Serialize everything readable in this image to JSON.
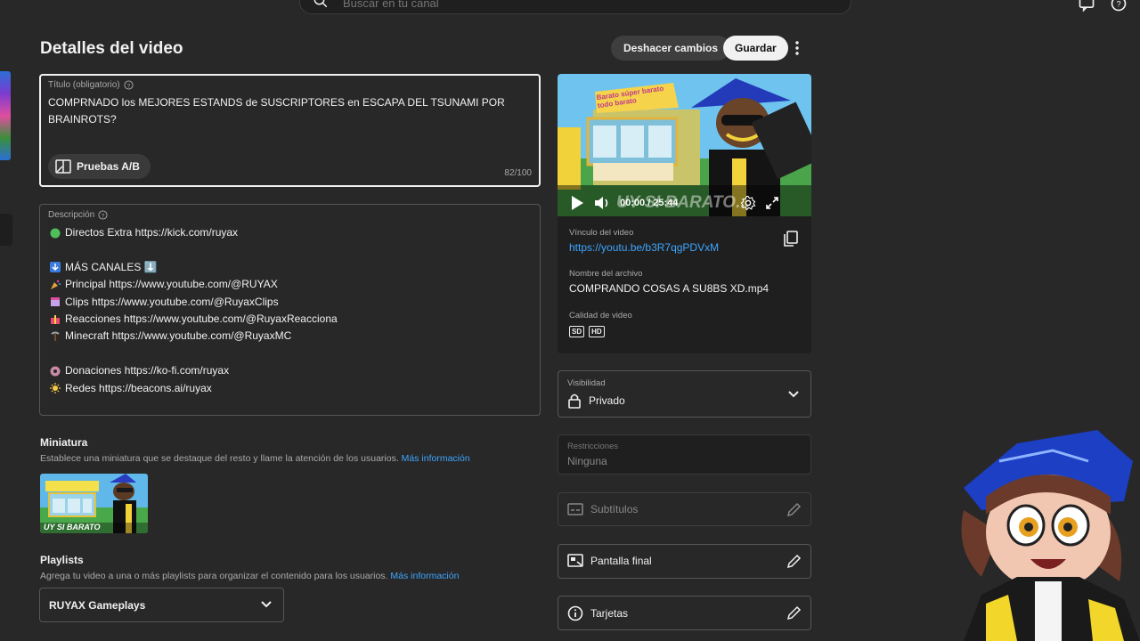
{
  "search": {
    "placeholder": "Buscar en tu canal"
  },
  "page": {
    "title": "Detalles del video"
  },
  "toolbar": {
    "undo_label": "Deshacer cambios",
    "save_label": "Guardar"
  },
  "title_field": {
    "label": "Título (obligatorio)",
    "value": "COMPRNADO los MEJORES ESTANDS de SUSCRIPTORES en ESCAPA DEL TSUNAMI POR BRAINROTS?",
    "counter": "82/100",
    "ab_label": "Pruebas A/B"
  },
  "description": {
    "label": "Descripción",
    "lines": [
      {
        "icon": "green-circle-icon",
        "text": "Directos Extra https://kick.com/ruyax"
      },
      {
        "icon": "",
        "text": ""
      },
      {
        "icon": "down-arrow-icon",
        "text": "MÁS CANALES ⬇️"
      },
      {
        "icon": "party-popper-icon",
        "text": "Principal https://www.youtube.com/@RUYAX"
      },
      {
        "icon": "clapper-icon",
        "text": "Clips https://www.youtube.com/@RuyaxClips"
      },
      {
        "icon": "gift-icon",
        "text": "Reacciones https://www.youtube.com/@RuyaxReacciona"
      },
      {
        "icon": "pickaxe-icon",
        "text": "Minecraft https://www.youtube.com/@RuyaxMC"
      },
      {
        "icon": "",
        "text": ""
      },
      {
        "icon": "donut-icon",
        "text": "Donaciones https://ko-fi.com/ruyax"
      },
      {
        "icon": "sun-icon",
        "text": "Redes https://beacons.ai/ruyax"
      }
    ]
  },
  "thumbnail": {
    "title": "Miniatura",
    "subtitle": "Establece una miniatura que se destaque del resto y llame la atención de los usuarios.",
    "link": "Más información",
    "overlay_text": "UY SI BARATO"
  },
  "playlists": {
    "title": "Playlists",
    "subtitle": "Agrega tu video a una o más playlists para organizar el contenido para los usuarios.",
    "link": "Más información",
    "selected": "RUYAX Gameplays"
  },
  "video": {
    "time": "00:00 / 25:44",
    "overlay_text": "UY SI BARATO...",
    "sign_text": "Barato súper barato todo barato",
    "link_label": "Vínculo del video",
    "link": "https://youtu.be/b3R7qgPDVxM",
    "filename_label": "Nombre del archivo",
    "filename": "COMPRANDO COSAS A SU8BS XD.mp4",
    "quality_label": "Calidad de video",
    "qualities": [
      "SD",
      "HD"
    ]
  },
  "visibility": {
    "label": "Visibilidad",
    "value": "Privado"
  },
  "restrictions": {
    "label": "Restricciones",
    "value": "Ninguna"
  },
  "subtitles": {
    "label": "Subtítulos"
  },
  "end_screen": {
    "label": "Pantalla final"
  },
  "cards": {
    "label": "Tarjetas"
  },
  "colors": {
    "background": "#282828",
    "link": "#3ea6ff",
    "primary_button": "#f1f1f1",
    "border": "#575757"
  }
}
